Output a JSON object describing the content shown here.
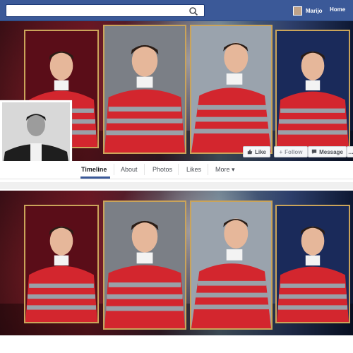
{
  "topbar": {
    "search": {
      "placeholder": "",
      "value": ""
    },
    "user_name": "Marijo",
    "home_label": "Home"
  },
  "profile": {
    "actions": {
      "like_label": "Like",
      "follow_label": "Follow",
      "message_label": "Message"
    },
    "tabs": [
      {
        "label": "Timeline",
        "active": true
      },
      {
        "label": "About",
        "active": false
      },
      {
        "label": "Photos",
        "active": false
      },
      {
        "label": "Likes",
        "active": false
      },
      {
        "label": "More",
        "active": false
      }
    ]
  },
  "colors": {
    "facebook_blue": "#3b5998",
    "frame_gold": "#caa45a",
    "shirt_red": "#d3262e"
  },
  "icons": {
    "search": "search-icon",
    "like": "thumbs-up-icon",
    "follow": "plus-icon",
    "message": "message-icon",
    "more": "caret-down-icon"
  }
}
